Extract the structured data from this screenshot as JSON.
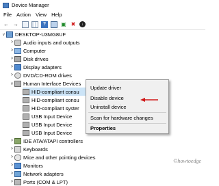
{
  "window": {
    "title": "Device Manager"
  },
  "menu": {
    "items": [
      "File",
      "Action",
      "View",
      "Help"
    ]
  },
  "toolbar": {
    "icons": [
      "back-arrow-icon",
      "forward-arrow-icon",
      "properties-icon",
      "grid-view-icon",
      "help-icon",
      "computer-screen-icon",
      "scan-hardware-icon",
      "remove-device-icon",
      "update-driver-icon"
    ]
  },
  "tree": {
    "root": "DESKTOP-U3MG8UF",
    "categories": [
      "Audio inputs and outputs",
      "Computer",
      "Disk drives",
      "Display adapters",
      "DVD/CD-ROM drives",
      "Human Interface Devices"
    ],
    "hid_children": [
      "HID-compliant consu",
      "HID-compliant consu",
      "HID-compliant syster",
      "USB Input Device",
      "USB Input Device",
      "USB Input Device"
    ],
    "after_categories": [
      "IDE ATA/ATAPI controllers",
      "Keyboards",
      "Mice and other pointing devices",
      "Monitors",
      "Network adapters",
      "Ports (COM & LPT)"
    ]
  },
  "context_menu": {
    "update": "Update driver",
    "disable": "Disable device",
    "uninstall": "Uninstall device",
    "scan": "Scan for hardware changes",
    "properties": "Properties"
  },
  "watermark": "©howtoedge",
  "colors": {
    "selection": "#cce4f7",
    "annotation_arrow": "#d01818"
  }
}
